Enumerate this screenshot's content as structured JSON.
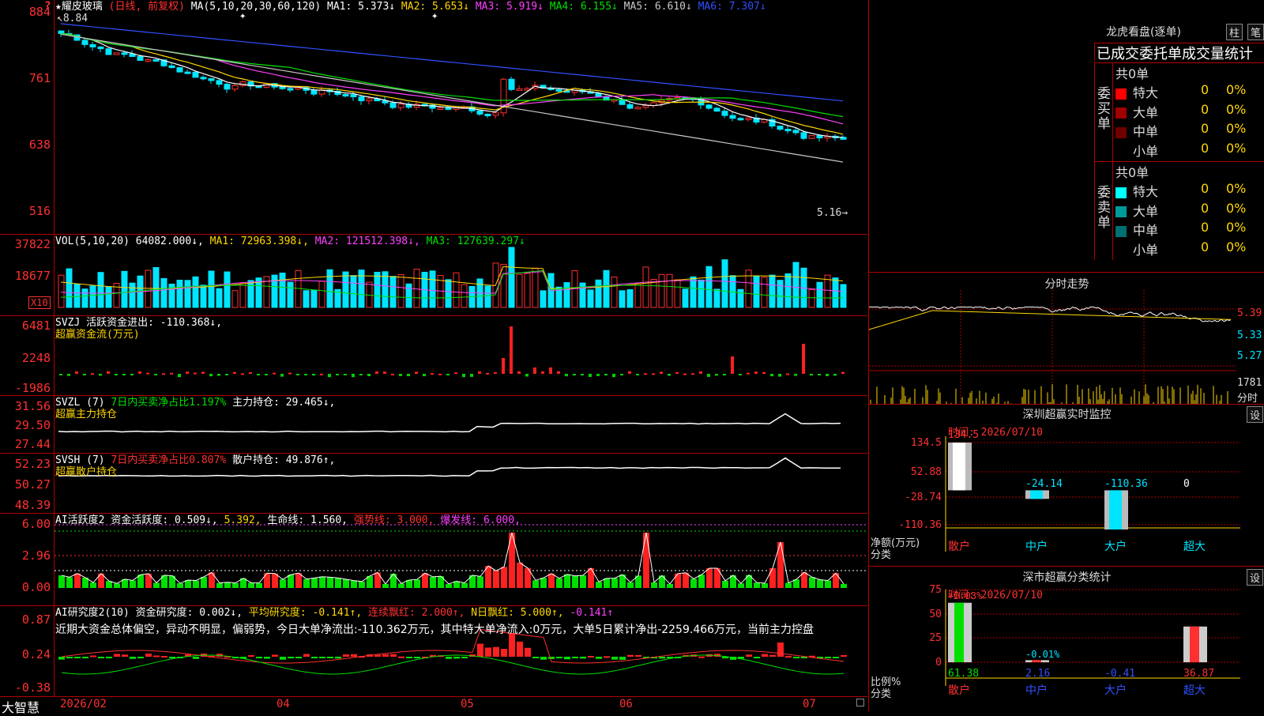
{
  "stock": {
    "name": "★耀皮玻璃",
    "mode": "(日线, 前复权)",
    "ma_header": "MA(5,10,20,30,60,120)",
    "ma": [
      {
        "label": "MA1:",
        "value": "5.373↓",
        "color": "#ffffff"
      },
      {
        "label": "MA2:",
        "value": "5.653↓",
        "color": "#ffd700"
      },
      {
        "label": "MA3:",
        "value": "5.919↓",
        "color": "#ff40ff"
      },
      {
        "label": "MA4:",
        "value": "6.155↓",
        "color": "#00e000"
      },
      {
        "label": "MA5:",
        "value": "6.610↓",
        "color": "#c8c8c8"
      },
      {
        "label": "MA6:",
        "value": "7.307↓",
        "color": "#3050ff"
      }
    ],
    "high_mark": "8.84",
    "low_mark": "5.16",
    "price_axis": [
      "884",
      "761",
      "638",
      "516"
    ]
  },
  "vol": {
    "label": "VOL(5,10,20)",
    "value": "64082.000↓,",
    "ma1": "MA1: 72963.398↓,",
    "ma2": "MA2: 121512.398↓,",
    "ma3": "MA3: 127639.297↓",
    "axis": [
      "37822",
      "18677"
    ],
    "unit": "X10"
  },
  "svzj": {
    "label": "SVZJ  活跃资金进出: -110.368↓,",
    "sub": "超赢资金流(万元)",
    "axis": [
      "6481",
      "2248",
      "-1986"
    ]
  },
  "svzl": {
    "label": "SVZL (7)",
    "pct": "7日内买卖净占比1.197%",
    "hold": "主力持仓: 29.465↓,",
    "sub": "超赢主力持仓",
    "axis": [
      "31.56",
      "29.50",
      "27.44"
    ]
  },
  "svsh": {
    "label": "SVSH (7)",
    "pct": "7日内买卖净占比0.807%",
    "hold": "散户持仓: 49.876↑,",
    "sub": "超赢散户持仓",
    "axis": [
      "52.23",
      "50.27",
      "48.39"
    ]
  },
  "ai1": {
    "label": "AI活跃度2",
    "a": "资金活跃度: 0.509↓,",
    "b": "5.392,",
    "c": "生命线: 1.560,",
    "d": "强势线: 3.000,",
    "e": "爆发线: 6.000,",
    "axis": [
      "6.00",
      "2.96",
      "0.00"
    ]
  },
  "ai2": {
    "label": "AI研究度2(10)",
    "a": "资金研究度: 0.002↓,",
    "b": "平均研究度: -0.141↑,",
    "c": "连续飘红: 2.000↑,",
    "d": "N日飘红: 5.000↑,",
    "e": "-0.141↑",
    "comment": "近期大资金总体偏空，异动不明显，偏弱势，今日大单净流出:-110.362万元，其中特大单净流入:0万元，大单5日累计净出-2259.466万元，当前主力控盘",
    "axis": [
      "0.87",
      "0.24",
      "-0.38"
    ]
  },
  "footer": {
    "brand": "大智慧",
    "dates": [
      "2026/02",
      "04",
      "05",
      "06",
      "07"
    ]
  },
  "right": {
    "lhb_title": "龙虎看盘(逐单)",
    "btn_zhu": "柱",
    "btn_bi": "笔",
    "tabs_title": "已成交委托单成交量统计",
    "buy": {
      "side": "委买单",
      "total": "共0单",
      "rows": [
        {
          "name": "特大",
          "v": "0",
          "p": "0%",
          "color": "#ff0000"
        },
        {
          "name": "大单",
          "v": "0",
          "p": "0%",
          "color": "#a00000"
        },
        {
          "name": "中单",
          "v": "0",
          "p": "0%",
          "color": "#700000"
        },
        {
          "name": "小单",
          "v": "0",
          "p": "0%",
          "color": ""
        }
      ]
    },
    "sell": {
      "side": "委卖单",
      "total": "共0单",
      "rows": [
        {
          "name": "特大",
          "v": "0",
          "p": "0%",
          "color": "#00ffff"
        },
        {
          "name": "大单",
          "v": "0",
          "p": "0%",
          "color": "#009a9a"
        },
        {
          "name": "中单",
          "v": "0",
          "p": "0%",
          "color": "#007070"
        },
        {
          "name": "小单",
          "v": "0",
          "p": "0%",
          "color": ""
        }
      ]
    },
    "intraday_title": "分时走势",
    "intraday_axis": [
      "5.39",
      "5.33",
      "5.27"
    ],
    "intraday_vol": "1781",
    "intraday_unit": "分时",
    "monitor_title": "深圳超赢实时监控",
    "monitor_btn": "设",
    "monitor_time": "时间: 2026/07/10",
    "monitor_axis": [
      "134.5",
      "52.88",
      "-28.74",
      "-110.36"
    ],
    "monitor_bars": [
      {
        "name": "散户",
        "value": "134.5"
      },
      {
        "name": "中户",
        "value": "-24.14"
      },
      {
        "name": "大户",
        "value": "-110.36"
      },
      {
        "name": "超大",
        "value": "0"
      }
    ],
    "monitor_ylabel": "净额(万元)",
    "monitor_xlabel": "分类",
    "class_title": "深市超赢分类统计",
    "class_btn": "设",
    "class_time": "时间: 2026/07/10",
    "class_axis": [
      "75",
      "50",
      "25",
      "0"
    ],
    "class_top": [
      "+0.03%",
      "-0.01%"
    ],
    "class_bars": [
      {
        "name": "散户",
        "value": "61.38"
      },
      {
        "name": "中户",
        "value": "2.16"
      },
      {
        "name": "大户",
        "value": "-0.41"
      },
      {
        "name": "超大",
        "value": "36.87"
      }
    ],
    "class_ylabel": "比例%",
    "class_xlabel": "分类"
  }
}
